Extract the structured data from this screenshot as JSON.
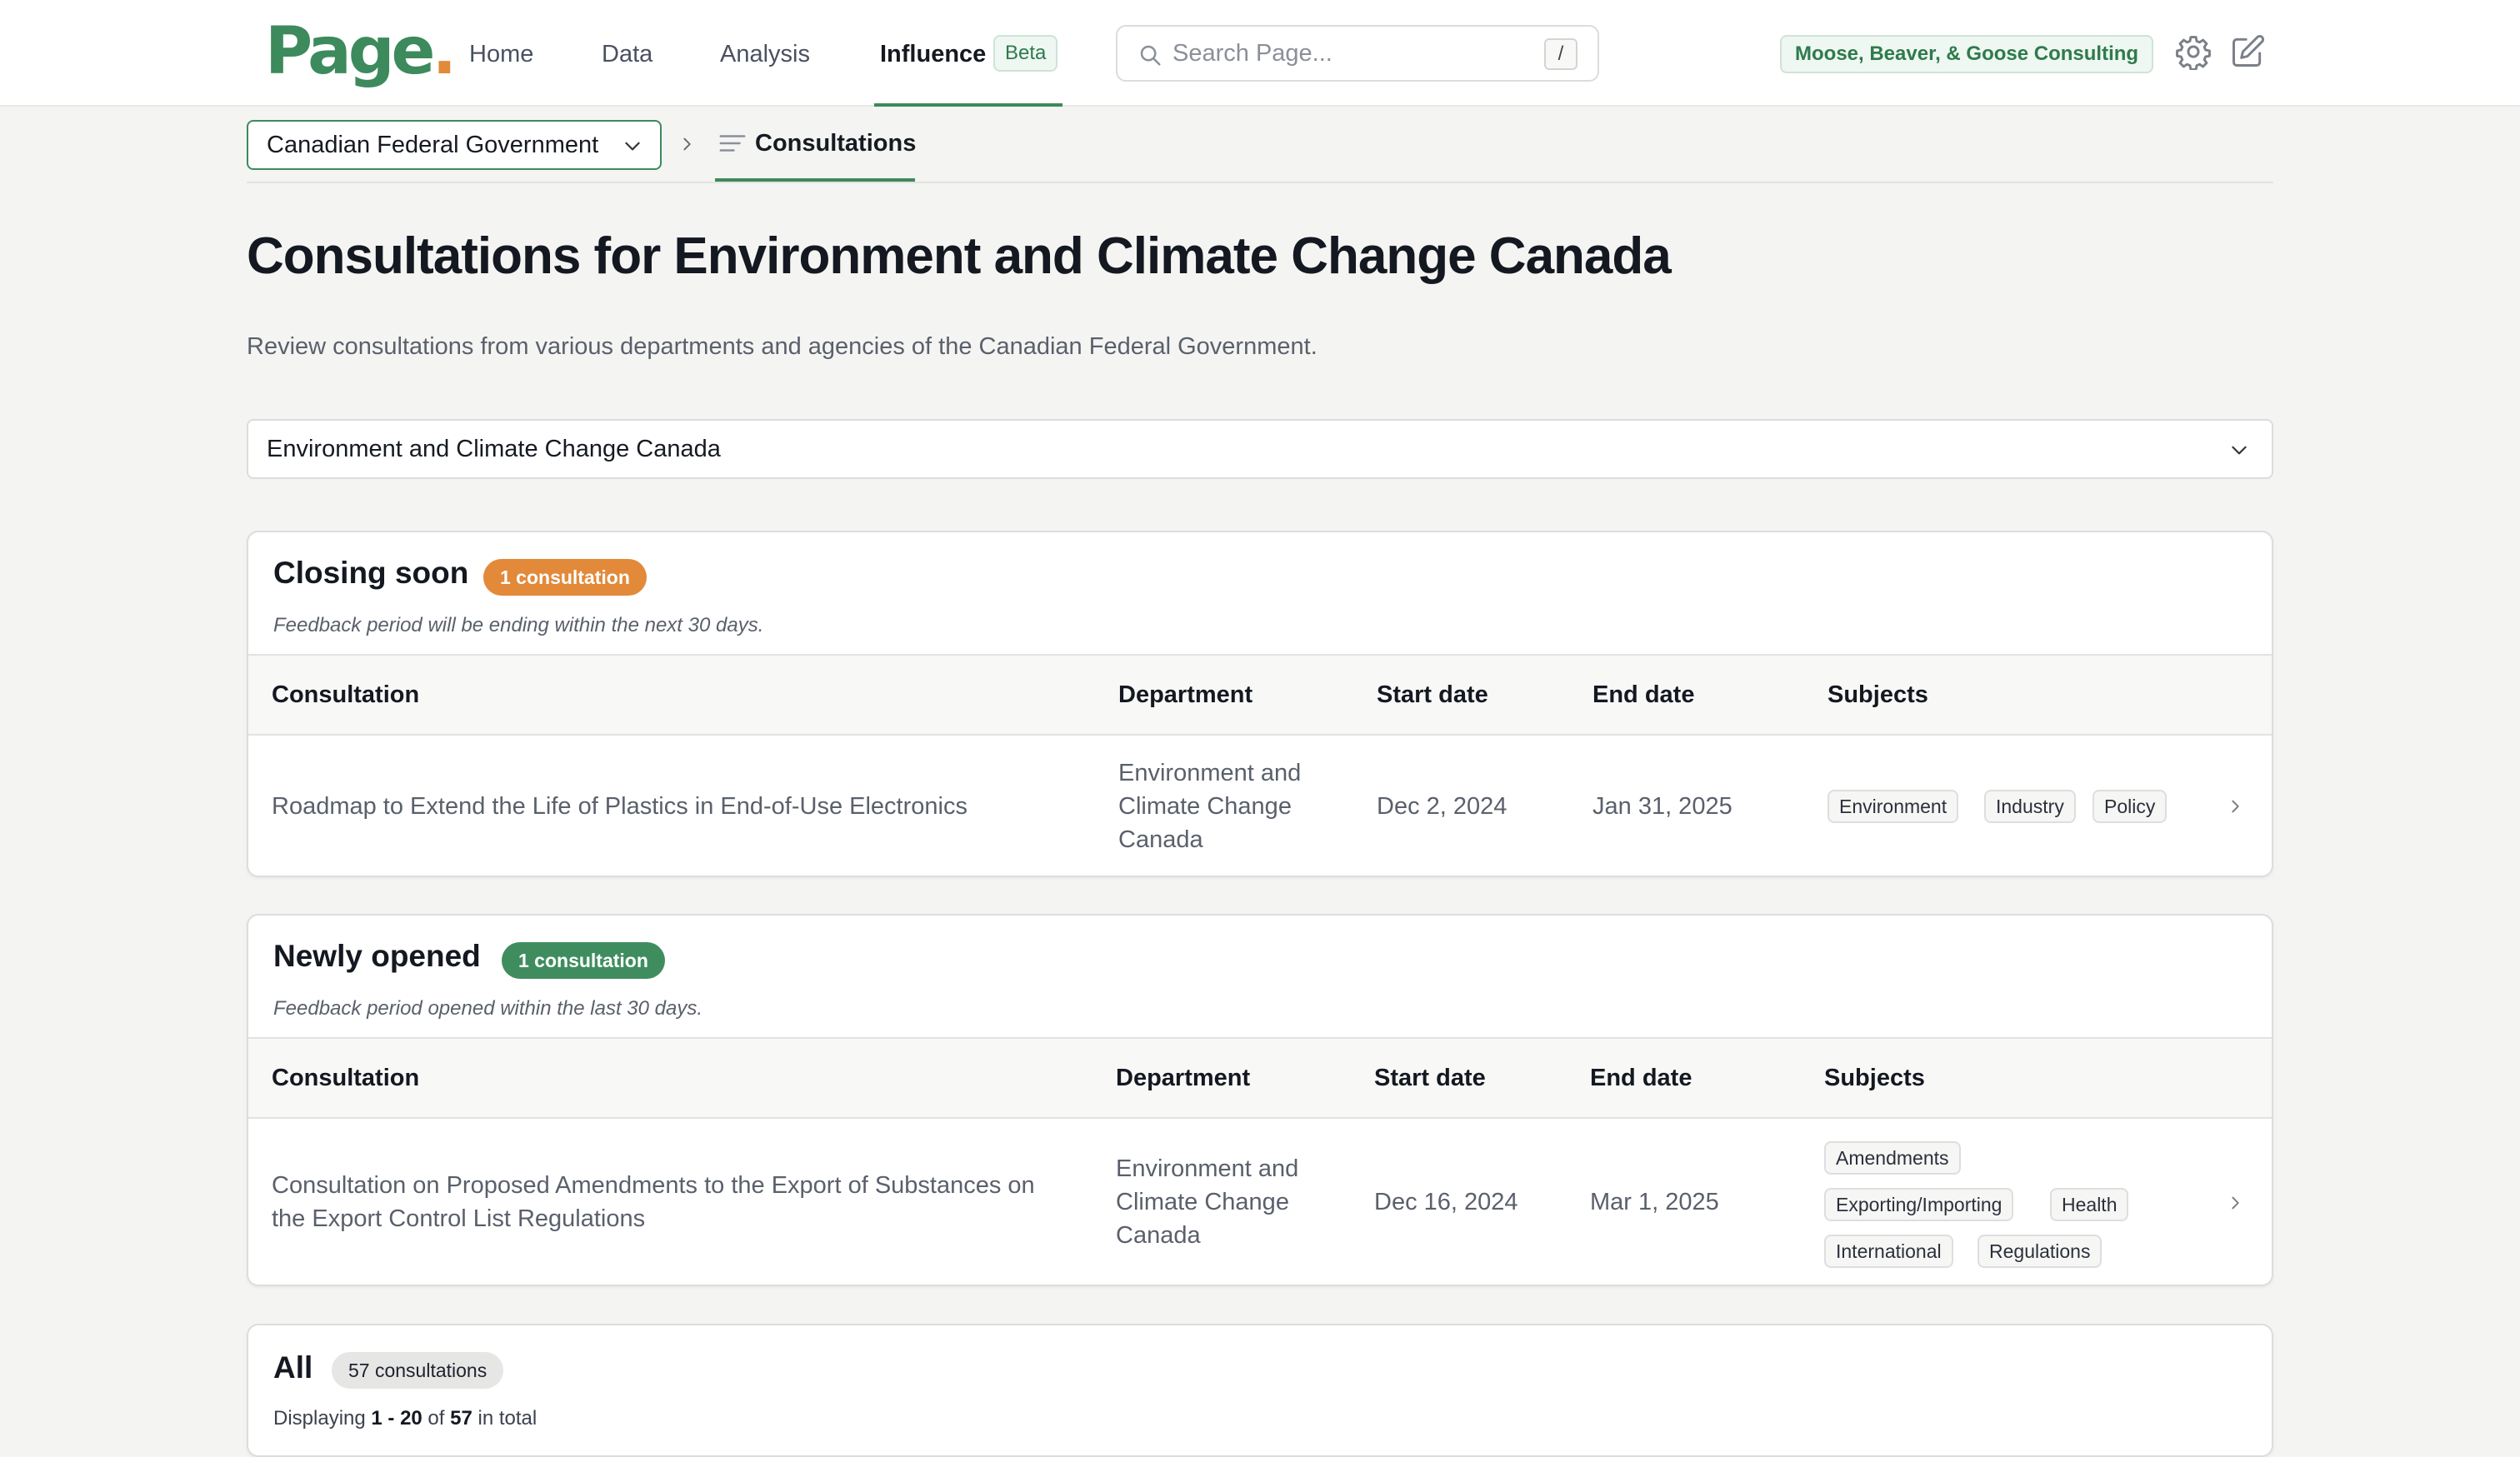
{
  "nav": {
    "logo_text": "Page",
    "logo_dot": ".",
    "items": [
      {
        "label": "Home"
      },
      {
        "label": "Data"
      },
      {
        "label": "Analysis"
      },
      {
        "label": "Influence",
        "active": true,
        "badge": "Beta"
      }
    ],
    "search": {
      "placeholder": "Search Page...",
      "shortcut": "/"
    },
    "org_name": "Moose, Beaver, & Goose Consulting",
    "icons": [
      "gear-icon",
      "edit-icon"
    ],
    "brand_color": "#3d8a5c",
    "accent_color": "#e08a3a"
  },
  "breadcrumb": {
    "selector": "Canadian Federal Government",
    "current": "Consultations"
  },
  "page": {
    "title": "Consultations for Environment and Climate Change Canada",
    "description": "Review consultations from various departments and agencies of the Canadian Federal Government.",
    "department_select": "Environment and Climate Change Canada"
  },
  "columns": {
    "consultation": "Consultation",
    "department": "Department",
    "start": "Start date",
    "end": "End date",
    "subjects": "Subjects"
  },
  "closing_soon": {
    "title": "Closing soon",
    "badge": "1 consultation",
    "badge_color": "#e2893a",
    "subtitle": "Feedback period will be ending within the next 30 days.",
    "rows": [
      {
        "consultation": "Roadmap to Extend the Life of Plastics in End-of-Use Electronics",
        "department": [
          "Environment and",
          "Climate Change",
          "Canada"
        ],
        "start": "Dec 2, 2024",
        "end": "Jan 31, 2025",
        "subjects": [
          "Environment",
          "Industry",
          "Policy"
        ]
      }
    ]
  },
  "newly_opened": {
    "title": "Newly opened",
    "badge": "1 consultation",
    "badge_color": "#3f8d5f",
    "subtitle": "Feedback period opened within the last 30 days.",
    "rows": [
      {
        "consultation": [
          "Consultation on Proposed Amendments to the Export of Substances on",
          "the Export Control List Regulations"
        ],
        "department": [
          "Environment and",
          "Climate Change",
          "Canada"
        ],
        "start": "Dec 16, 2024",
        "end": "Mar 1, 2025",
        "subjects": [
          "Amendments",
          "Exporting/Importing",
          "Health",
          "International",
          "Regulations"
        ]
      }
    ]
  },
  "all": {
    "title": "All",
    "badge": "57 consultations",
    "displaying_prefix": "Displaying ",
    "range": "1 - 20",
    "of": " of ",
    "total": "57",
    "suffix": " in total"
  }
}
